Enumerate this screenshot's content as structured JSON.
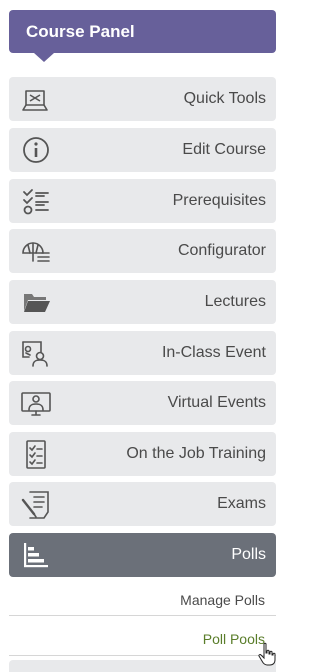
{
  "header": {
    "title": "Course Panel"
  },
  "menu": [
    {
      "label": "Quick Tools",
      "icon": "quick-tools-icon"
    },
    {
      "label": "Edit Course",
      "icon": "info-icon"
    },
    {
      "label": "Prerequisites",
      "icon": "checklist-icon"
    },
    {
      "label": "Configurator",
      "icon": "configurator-icon"
    },
    {
      "label": "Lectures",
      "icon": "folder-icon"
    },
    {
      "label": "In-Class Event",
      "icon": "in-class-event-icon"
    },
    {
      "label": "Virtual Events",
      "icon": "virtual-events-icon"
    },
    {
      "label": "On the Job Training",
      "icon": "clipboard-checklist-icon"
    },
    {
      "label": "Exams",
      "icon": "exam-icon"
    },
    {
      "label": "Polls",
      "icon": "polls-icon",
      "active": true
    }
  ],
  "submenu": [
    {
      "label": "Manage Polls"
    },
    {
      "label": "Poll Pools",
      "current": true
    }
  ],
  "colors": {
    "header_bg": "#67609a",
    "item_bg": "#e8e9eb",
    "active_bg": "#6b7079",
    "current_sub_text": "#5a7d2a"
  }
}
